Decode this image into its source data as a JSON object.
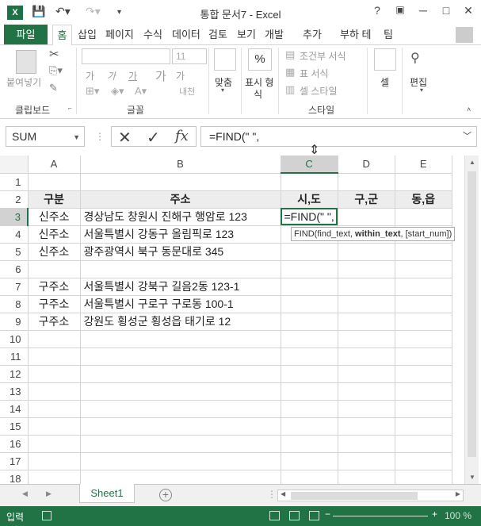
{
  "window": {
    "app_icon": "X",
    "title": "통합 문서7 - Excel",
    "help": "?",
    "min": "─",
    "restore": "□",
    "close": "✕"
  },
  "tabs": {
    "file": "파일",
    "items": [
      "홈",
      "삽입",
      "페이지",
      "수식",
      "데이터",
      "검토",
      "보기",
      "개발",
      "추가",
      "부하 테",
      "팀"
    ]
  },
  "ribbon": {
    "paste": "붙여넣기",
    "clipboard": "클립보드",
    "font_size": "11",
    "font_group": "글꼴",
    "bold_glyph": "가",
    "align": "맞춤",
    "number_format_top": "%",
    "number_format": "표시 형",
    "number_format2": "식",
    "conditional": "조건부 서식",
    "table_format": "표 서식",
    "cell_style": "셀 스타일",
    "styles_group": "스타일",
    "cells": "셀",
    "editing": "편집"
  },
  "formula_bar": {
    "name_box": "SUM",
    "cancel": "✕",
    "enter": "✓",
    "fx": "fx",
    "formula": "=FIND(\" \","
  },
  "columns": [
    "A",
    "B",
    "C",
    "D",
    "E"
  ],
  "rows": [
    {
      "n": "1",
      "a": "",
      "b": "",
      "c": "",
      "d": "",
      "e": ""
    },
    {
      "n": "2",
      "a": "구분",
      "b": "주소",
      "c": "시,도",
      "d": "구,군",
      "e": "동,읍"
    },
    {
      "n": "3",
      "a": "신주소",
      "b": "경상남도 창원시 진해구 행암로 123",
      "c": "=FIND(\" \",",
      "d": "",
      "e": ""
    },
    {
      "n": "4",
      "a": "신주소",
      "b": "서울특별시 강동구 올림픽로 123",
      "c": "",
      "d": "",
      "e": ""
    },
    {
      "n": "5",
      "a": "신주소",
      "b": "광주광역시 북구 동문대로 345",
      "c": "",
      "d": "",
      "e": ""
    },
    {
      "n": "6",
      "a": "",
      "b": "",
      "c": "",
      "d": "",
      "e": ""
    },
    {
      "n": "7",
      "a": "구주소",
      "b": "서울특별시 강북구 길음2동 123-1",
      "c": "",
      "d": "",
      "e": ""
    },
    {
      "n": "8",
      "a": "구주소",
      "b": "서울특별시 구로구 구로동 100-1",
      "c": "",
      "d": "",
      "e": ""
    },
    {
      "n": "9",
      "a": "구주소",
      "b": "강원도 횡성군 횡성읍 태기로 12",
      "c": "",
      "d": "",
      "e": ""
    },
    {
      "n": "10",
      "a": "",
      "b": "",
      "c": "",
      "d": "",
      "e": ""
    },
    {
      "n": "11",
      "a": "",
      "b": "",
      "c": "",
      "d": "",
      "e": ""
    },
    {
      "n": "12",
      "a": "",
      "b": "",
      "c": "",
      "d": "",
      "e": ""
    },
    {
      "n": "13",
      "a": "",
      "b": "",
      "c": "",
      "d": "",
      "e": ""
    },
    {
      "n": "14",
      "a": "",
      "b": "",
      "c": "",
      "d": "",
      "e": ""
    },
    {
      "n": "15",
      "a": "",
      "b": "",
      "c": "",
      "d": "",
      "e": ""
    },
    {
      "n": "16",
      "a": "",
      "b": "",
      "c": "",
      "d": "",
      "e": ""
    },
    {
      "n": "17",
      "a": "",
      "b": "",
      "c": "",
      "d": "",
      "e": ""
    },
    {
      "n": "18",
      "a": "",
      "b": "",
      "c": "",
      "d": "",
      "e": ""
    }
  ],
  "tooltip": {
    "prefix": "FIND(find_text, ",
    "bold": "within_text",
    "suffix": ", [start_num])"
  },
  "sheets": {
    "active": "Sheet1",
    "add": "+"
  },
  "status": {
    "mode": "입력",
    "zoom": "100 %"
  }
}
